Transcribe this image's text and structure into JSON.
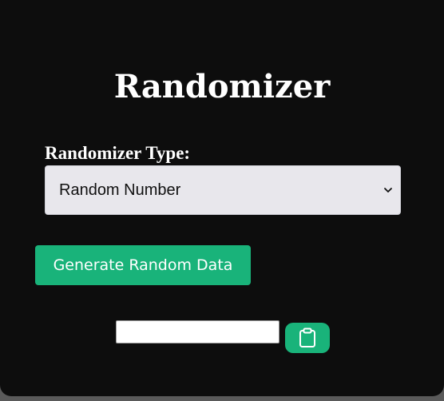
{
  "app": {
    "title": "Randomizer"
  },
  "type_selector": {
    "label": "Randomizer Type:",
    "selected": "Random Number"
  },
  "actions": {
    "generate_label": "Generate Random Data",
    "copy_icon": "clipboard-icon"
  },
  "output": {
    "value": "",
    "placeholder": ""
  },
  "colors": {
    "background": "#0d0d0d",
    "accent": "#19b37a",
    "select_bg": "#e8e7ec",
    "text": "#ffffff"
  }
}
